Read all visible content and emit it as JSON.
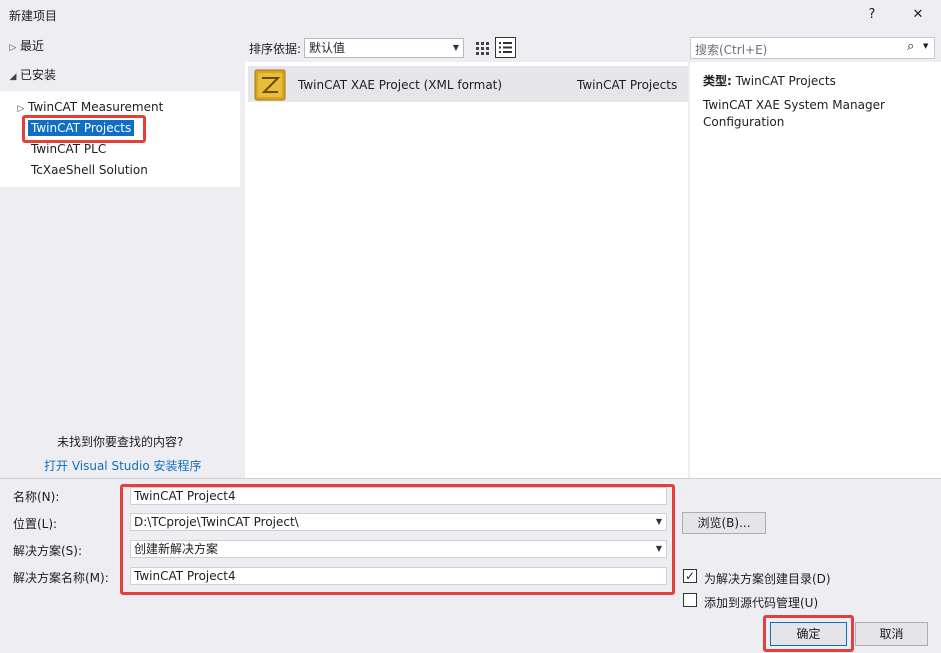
{
  "window": {
    "title": "新建项目",
    "help_label": "?",
    "close_label": "✕"
  },
  "left": {
    "recent_label": "最近",
    "installed_label": "已安装",
    "tree_items": [
      {
        "label": "TwinCAT Measurement"
      },
      {
        "label": "TwinCAT Projects"
      },
      {
        "label": "TwinCAT PLC"
      },
      {
        "label": "TcXaeShell Solution"
      }
    ],
    "not_found_text": "未找到你要查找的内容?",
    "open_installer_link": "打开 Visual Studio 安装程序"
  },
  "toolbar": {
    "sort_label": "排序依据:",
    "sort_value": "默认值",
    "search_placeholder": "搜索(Ctrl+E)"
  },
  "templates": [
    {
      "name": "TwinCAT XAE Project (XML format)",
      "category": "TwinCAT Projects"
    }
  ],
  "details": {
    "type_label": "类型:",
    "type_value": "TwinCAT Projects",
    "description": "TwinCAT XAE System Manager Configuration"
  },
  "form": {
    "name_label": "名称(N):",
    "name_value": "TwinCAT Project4",
    "location_label": "位置(L):",
    "location_value": "D:\\TCproje\\TwinCAT Project\\",
    "solution_label": "解决方案(S):",
    "solution_value": "创建新解决方案",
    "solution_name_label": "解决方案名称(M):",
    "solution_name_value": "TwinCAT Project4",
    "browse_label": "浏览(B)...",
    "create_dir_label": "为解决方案创建目录(D)",
    "create_dir_checked": true,
    "source_control_label": "添加到源代码管理(U)",
    "source_control_checked": false
  },
  "buttons": {
    "ok_label": "确定",
    "cancel_label": "取消"
  },
  "colors": {
    "selection": "#0f6fc6",
    "highlight_box": "#e3403a",
    "link": "#0e70c0",
    "icon_gold": "#d9a520"
  }
}
